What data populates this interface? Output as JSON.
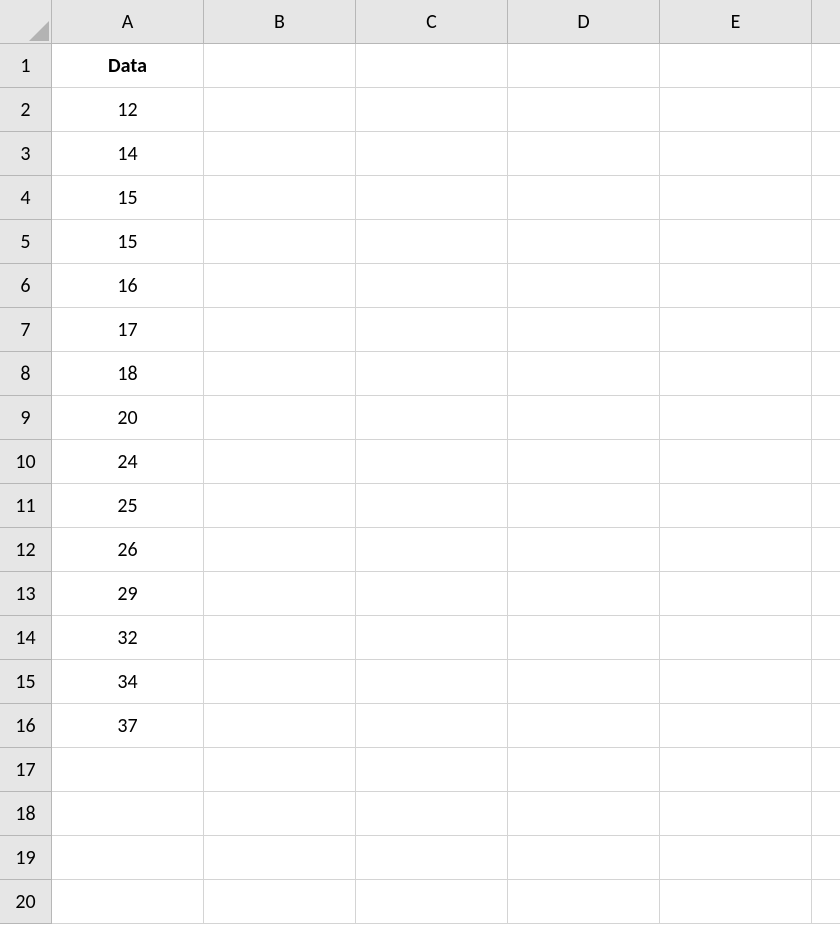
{
  "columns": [
    "A",
    "B",
    "C",
    "D",
    "E",
    ""
  ],
  "rowCount": 20,
  "cells": {
    "A1": {
      "text": "Data",
      "bold": true
    },
    "A2": {
      "text": "12"
    },
    "A3": {
      "text": "14"
    },
    "A4": {
      "text": "15"
    },
    "A5": {
      "text": "15"
    },
    "A6": {
      "text": "16"
    },
    "A7": {
      "text": "17"
    },
    "A8": {
      "text": "18"
    },
    "A9": {
      "text": "20"
    },
    "A10": {
      "text": "24"
    },
    "A11": {
      "text": "25"
    },
    "A12": {
      "text": "26"
    },
    "A13": {
      "text": "29"
    },
    "A14": {
      "text": "32"
    },
    "A15": {
      "text": "34"
    },
    "A16": {
      "text": "37"
    }
  }
}
